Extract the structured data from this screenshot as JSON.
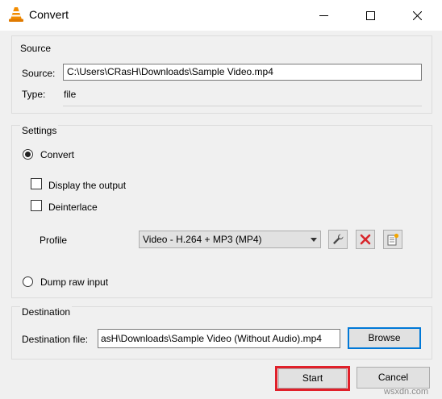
{
  "window": {
    "title": "Convert",
    "icon": "vlc-cone-icon"
  },
  "source_group": {
    "title": "Source",
    "source_label": "Source:",
    "source_value": "C:\\Users\\CRasH\\Downloads\\Sample Video.mp4",
    "type_label": "Type:",
    "type_value": "file"
  },
  "settings_group": {
    "title": "Settings",
    "convert_label": "Convert",
    "convert_checked": true,
    "display_output_label": "Display the output",
    "display_output_checked": false,
    "deinterlace_label": "Deinterlace",
    "deinterlace_checked": false,
    "profile_label": "Profile",
    "profile_value": "Video - H.264 + MP3 (MP4)",
    "dump_raw_label": "Dump raw input",
    "dump_raw_checked": false
  },
  "destination_group": {
    "title": "Destination",
    "file_label": "Destination file:",
    "file_value": "asH\\Downloads\\Sample Video (Without Audio).mp4",
    "browse_label": "Browse"
  },
  "footer": {
    "start_label": "Start",
    "cancel_label": "Cancel",
    "watermark": "wsxdn.com"
  },
  "colors": {
    "highlight": "#e0202a",
    "focus_border": "#0078d7",
    "vlc_orange": "#f28c00"
  }
}
